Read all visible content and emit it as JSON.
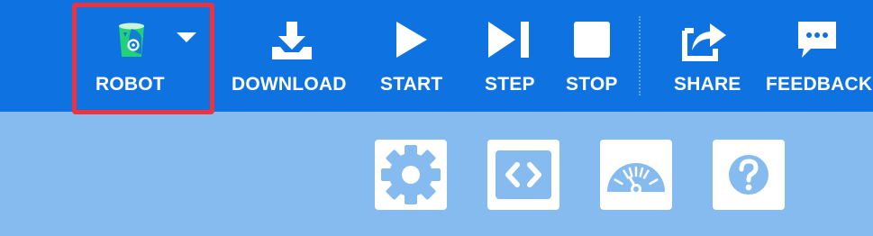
{
  "toolbar": {
    "robot_label": "ROBOT",
    "download_label": "DOWNLOAD",
    "start_label": "START",
    "step_label": "STEP",
    "stop_label": "STOP",
    "share_label": "SHARE",
    "feedback_label": "FEEDBACK"
  },
  "icons": {
    "robot": "robot-icon",
    "dropdown": "chevron-down-icon",
    "download": "download-icon",
    "start": "play-icon",
    "step": "step-icon",
    "stop": "stop-icon",
    "share": "share-icon",
    "feedback": "feedback-icon",
    "settings": "gear-icon",
    "code": "code-icon",
    "speed": "speedometer-icon",
    "help": "question-mark-icon"
  },
  "colors": {
    "toolbar_bg": "#0E72E0",
    "page_bg": "#85BBEF",
    "highlight": "#EC3340",
    "robot_accent": "#21D07A",
    "button_icon": "#85BBEF"
  }
}
